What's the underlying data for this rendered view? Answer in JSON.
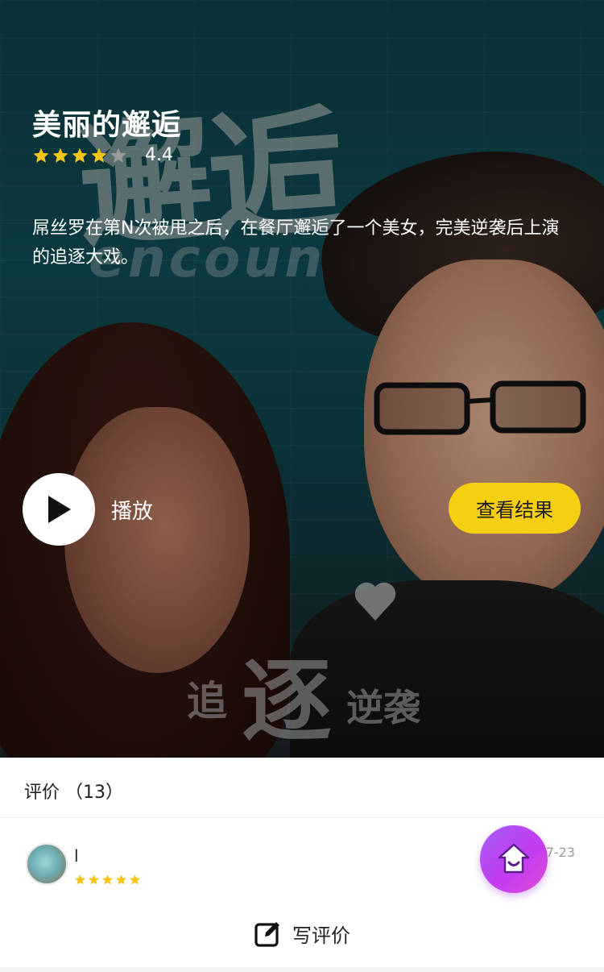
{
  "hero": {
    "title": "美丽的邂逅",
    "rating": 4.4,
    "rating_text": "4.4",
    "stars_filled": 4,
    "stars_total": 5,
    "synopsis": "屌丝罗在第N次被甩之后，在餐厅邂逅了一个美女，完美逆袭后上演的追逐大戏。",
    "poster_text": {
      "top_calligraphy": "邂逅",
      "top_script": "encounter",
      "bottom_left": "追",
      "bottom_center": "逐",
      "bottom_right": "逆袭"
    },
    "play_label": "播放",
    "result_button_label": "查看结果"
  },
  "reviews": {
    "header_label": "评价 （13）",
    "items": [
      {
        "name": "l",
        "stars": 5,
        "date": "7-23"
      }
    ]
  },
  "footer": {
    "write_review_label": "写评价"
  },
  "colors": {
    "accent_yellow": "#f6cf13",
    "star_yellow": "#f5c518",
    "fab_purple": "#b64bf2"
  },
  "icons": {
    "play": "play-icon",
    "home": "home-icon",
    "edit": "edit-icon",
    "star": "star-icon"
  }
}
